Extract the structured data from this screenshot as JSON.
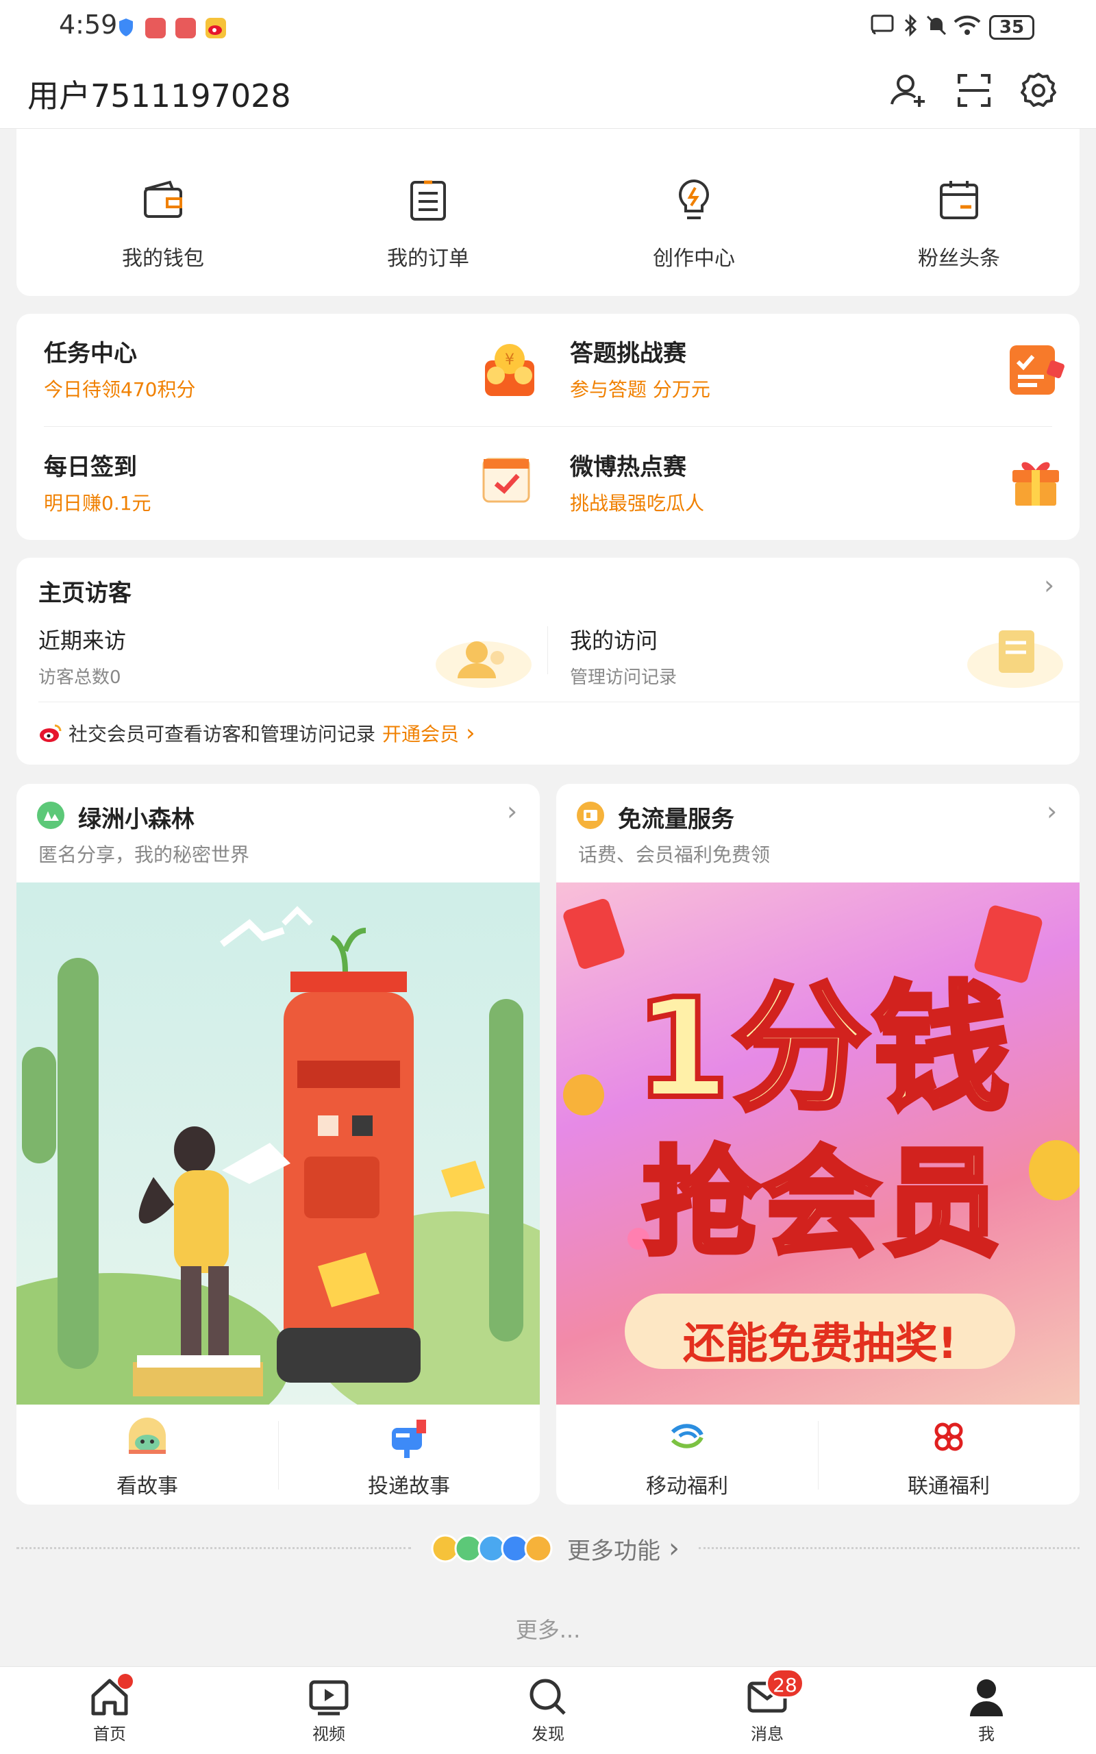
{
  "status_bar": {
    "time": "4:59",
    "battery": "35",
    "icons": [
      "security-shield-icon",
      "app-badge-icon",
      "app-badge-icon",
      "weibo-icon",
      "cast-icon",
      "bluetooth-icon",
      "mute-icon",
      "wifi-icon"
    ]
  },
  "header": {
    "username": "用户7511197028",
    "icons": [
      "add-friend-icon",
      "scan-icon",
      "settings-icon"
    ]
  },
  "quick_menu": [
    {
      "label": "我的钱包",
      "icon": "wallet-icon"
    },
    {
      "label": "我的订单",
      "icon": "order-icon"
    },
    {
      "label": "创作中心",
      "icon": "bulb-icon"
    },
    {
      "label": "粉丝头条",
      "icon": "calendar-icon"
    }
  ],
  "tasks": [
    {
      "title": "任务中心",
      "subtitle": "今日待领470积分",
      "icon": "coins-icon"
    },
    {
      "title": "答题挑战赛",
      "subtitle": "参与答题 分万元",
      "icon": "quiz-icon"
    },
    {
      "title": "每日签到",
      "subtitle": "明日赚0.1元",
      "icon": "checkin-calendar-icon"
    },
    {
      "title": "微博热点赛",
      "subtitle": "挑战最强吃瓜人",
      "icon": "gift-icon"
    }
  ],
  "visitors": {
    "title": "主页访客",
    "recent_title": "近期来访",
    "recent_sub": "访客总数0",
    "mine_title": "我的访问",
    "mine_sub": "管理访问记录",
    "promo_text": "社交会员可查看访客和管理访问记录",
    "promo_link": "开通会员"
  },
  "panels": [
    {
      "title": "绿洲小森林",
      "subtitle": "匿名分享，我的秘密世界",
      "footer": [
        {
          "label": "看故事"
        },
        {
          "label": "投递故事"
        }
      ]
    },
    {
      "title": "免流量服务",
      "subtitle": "话费、会员福利免费领",
      "banner_line1": "1分钱",
      "banner_line2": "抢会员",
      "banner_line3": "还能免费抽奖!",
      "footer": [
        {
          "label": "移动福利"
        },
        {
          "label": "联通福利"
        }
      ]
    }
  ],
  "more_functions": "更多功能",
  "more": "更多...",
  "bottom_nav": [
    {
      "label": "首页",
      "icon": "home-icon"
    },
    {
      "label": "视频",
      "icon": "video-icon"
    },
    {
      "label": "发现",
      "icon": "discover-icon"
    },
    {
      "label": "消息",
      "icon": "message-icon",
      "badge": "28"
    },
    {
      "label": "我",
      "icon": "profile-icon"
    }
  ],
  "colors": {
    "accent": "#f08000",
    "badge": "#e8352a"
  }
}
